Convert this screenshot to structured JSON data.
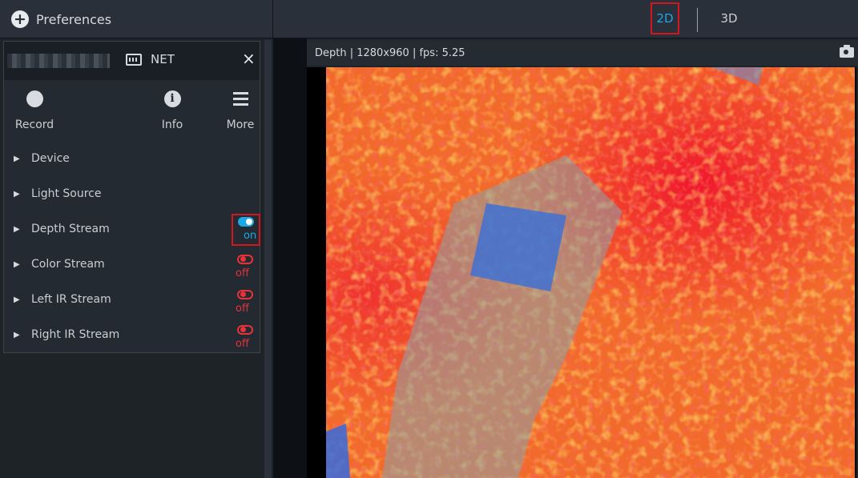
{
  "topbar": {
    "preferences_label": "Preferences",
    "tabs": [
      {
        "label": "2D",
        "active": true
      },
      {
        "label": "3D",
        "active": false
      }
    ]
  },
  "device_panel": {
    "device_name": "",
    "connection_label": "NET",
    "close_icon": "×",
    "toolbar": [
      {
        "label": "Record",
        "icon": "record-dot-icon"
      },
      {
        "label": "Info",
        "icon": "info-circle-icon"
      },
      {
        "label": "More",
        "icon": "hamburger-menu-icon"
      }
    ],
    "sections": [
      {
        "label": "Device"
      },
      {
        "label": "Light Source"
      },
      {
        "label": "Depth Stream",
        "toggle": "on"
      },
      {
        "label": "Color Stream",
        "toggle": "off"
      },
      {
        "label": "Left IR Stream",
        "toggle": "off"
      },
      {
        "label": "Right IR Stream",
        "toggle": "off"
      }
    ]
  },
  "viewer": {
    "title": "Depth | 1280x960 | fps: 5.25",
    "camera_icon": "camera-icon"
  },
  "colors": {
    "accent_blue": "#1ea7e4",
    "highlight_red": "#d4171e",
    "off_red": "#e8323a"
  }
}
